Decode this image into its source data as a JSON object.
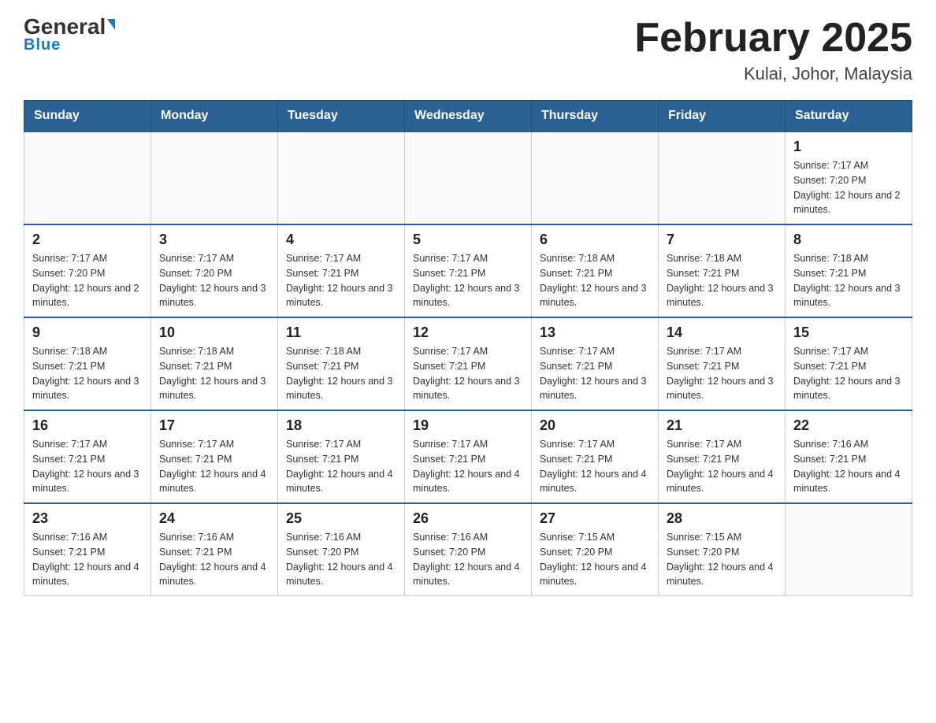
{
  "header": {
    "logo_general": "General",
    "logo_blue": "Blue",
    "title": "February 2025",
    "subtitle": "Kulai, Johor, Malaysia"
  },
  "weekdays": [
    "Sunday",
    "Monday",
    "Tuesday",
    "Wednesday",
    "Thursday",
    "Friday",
    "Saturday"
  ],
  "weeks": [
    [
      {
        "day": "",
        "sunrise": "",
        "sunset": "",
        "daylight": ""
      },
      {
        "day": "",
        "sunrise": "",
        "sunset": "",
        "daylight": ""
      },
      {
        "day": "",
        "sunrise": "",
        "sunset": "",
        "daylight": ""
      },
      {
        "day": "",
        "sunrise": "",
        "sunset": "",
        "daylight": ""
      },
      {
        "day": "",
        "sunrise": "",
        "sunset": "",
        "daylight": ""
      },
      {
        "day": "",
        "sunrise": "",
        "sunset": "",
        "daylight": ""
      },
      {
        "day": "1",
        "sunrise": "Sunrise: 7:17 AM",
        "sunset": "Sunset: 7:20 PM",
        "daylight": "Daylight: 12 hours and 2 minutes."
      }
    ],
    [
      {
        "day": "2",
        "sunrise": "Sunrise: 7:17 AM",
        "sunset": "Sunset: 7:20 PM",
        "daylight": "Daylight: 12 hours and 2 minutes."
      },
      {
        "day": "3",
        "sunrise": "Sunrise: 7:17 AM",
        "sunset": "Sunset: 7:20 PM",
        "daylight": "Daylight: 12 hours and 3 minutes."
      },
      {
        "day": "4",
        "sunrise": "Sunrise: 7:17 AM",
        "sunset": "Sunset: 7:21 PM",
        "daylight": "Daylight: 12 hours and 3 minutes."
      },
      {
        "day": "5",
        "sunrise": "Sunrise: 7:17 AM",
        "sunset": "Sunset: 7:21 PM",
        "daylight": "Daylight: 12 hours and 3 minutes."
      },
      {
        "day": "6",
        "sunrise": "Sunrise: 7:18 AM",
        "sunset": "Sunset: 7:21 PM",
        "daylight": "Daylight: 12 hours and 3 minutes."
      },
      {
        "day": "7",
        "sunrise": "Sunrise: 7:18 AM",
        "sunset": "Sunset: 7:21 PM",
        "daylight": "Daylight: 12 hours and 3 minutes."
      },
      {
        "day": "8",
        "sunrise": "Sunrise: 7:18 AM",
        "sunset": "Sunset: 7:21 PM",
        "daylight": "Daylight: 12 hours and 3 minutes."
      }
    ],
    [
      {
        "day": "9",
        "sunrise": "Sunrise: 7:18 AM",
        "sunset": "Sunset: 7:21 PM",
        "daylight": "Daylight: 12 hours and 3 minutes."
      },
      {
        "day": "10",
        "sunrise": "Sunrise: 7:18 AM",
        "sunset": "Sunset: 7:21 PM",
        "daylight": "Daylight: 12 hours and 3 minutes."
      },
      {
        "day": "11",
        "sunrise": "Sunrise: 7:18 AM",
        "sunset": "Sunset: 7:21 PM",
        "daylight": "Daylight: 12 hours and 3 minutes."
      },
      {
        "day": "12",
        "sunrise": "Sunrise: 7:17 AM",
        "sunset": "Sunset: 7:21 PM",
        "daylight": "Daylight: 12 hours and 3 minutes."
      },
      {
        "day": "13",
        "sunrise": "Sunrise: 7:17 AM",
        "sunset": "Sunset: 7:21 PM",
        "daylight": "Daylight: 12 hours and 3 minutes."
      },
      {
        "day": "14",
        "sunrise": "Sunrise: 7:17 AM",
        "sunset": "Sunset: 7:21 PM",
        "daylight": "Daylight: 12 hours and 3 minutes."
      },
      {
        "day": "15",
        "sunrise": "Sunrise: 7:17 AM",
        "sunset": "Sunset: 7:21 PM",
        "daylight": "Daylight: 12 hours and 3 minutes."
      }
    ],
    [
      {
        "day": "16",
        "sunrise": "Sunrise: 7:17 AM",
        "sunset": "Sunset: 7:21 PM",
        "daylight": "Daylight: 12 hours and 3 minutes."
      },
      {
        "day": "17",
        "sunrise": "Sunrise: 7:17 AM",
        "sunset": "Sunset: 7:21 PM",
        "daylight": "Daylight: 12 hours and 4 minutes."
      },
      {
        "day": "18",
        "sunrise": "Sunrise: 7:17 AM",
        "sunset": "Sunset: 7:21 PM",
        "daylight": "Daylight: 12 hours and 4 minutes."
      },
      {
        "day": "19",
        "sunrise": "Sunrise: 7:17 AM",
        "sunset": "Sunset: 7:21 PM",
        "daylight": "Daylight: 12 hours and 4 minutes."
      },
      {
        "day": "20",
        "sunrise": "Sunrise: 7:17 AM",
        "sunset": "Sunset: 7:21 PM",
        "daylight": "Daylight: 12 hours and 4 minutes."
      },
      {
        "day": "21",
        "sunrise": "Sunrise: 7:17 AM",
        "sunset": "Sunset: 7:21 PM",
        "daylight": "Daylight: 12 hours and 4 minutes."
      },
      {
        "day": "22",
        "sunrise": "Sunrise: 7:16 AM",
        "sunset": "Sunset: 7:21 PM",
        "daylight": "Daylight: 12 hours and 4 minutes."
      }
    ],
    [
      {
        "day": "23",
        "sunrise": "Sunrise: 7:16 AM",
        "sunset": "Sunset: 7:21 PM",
        "daylight": "Daylight: 12 hours and 4 minutes."
      },
      {
        "day": "24",
        "sunrise": "Sunrise: 7:16 AM",
        "sunset": "Sunset: 7:21 PM",
        "daylight": "Daylight: 12 hours and 4 minutes."
      },
      {
        "day": "25",
        "sunrise": "Sunrise: 7:16 AM",
        "sunset": "Sunset: 7:20 PM",
        "daylight": "Daylight: 12 hours and 4 minutes."
      },
      {
        "day": "26",
        "sunrise": "Sunrise: 7:16 AM",
        "sunset": "Sunset: 7:20 PM",
        "daylight": "Daylight: 12 hours and 4 minutes."
      },
      {
        "day": "27",
        "sunrise": "Sunrise: 7:15 AM",
        "sunset": "Sunset: 7:20 PM",
        "daylight": "Daylight: 12 hours and 4 minutes."
      },
      {
        "day": "28",
        "sunrise": "Sunrise: 7:15 AM",
        "sunset": "Sunset: 7:20 PM",
        "daylight": "Daylight: 12 hours and 4 minutes."
      },
      {
        "day": "",
        "sunrise": "",
        "sunset": "",
        "daylight": ""
      }
    ]
  ]
}
